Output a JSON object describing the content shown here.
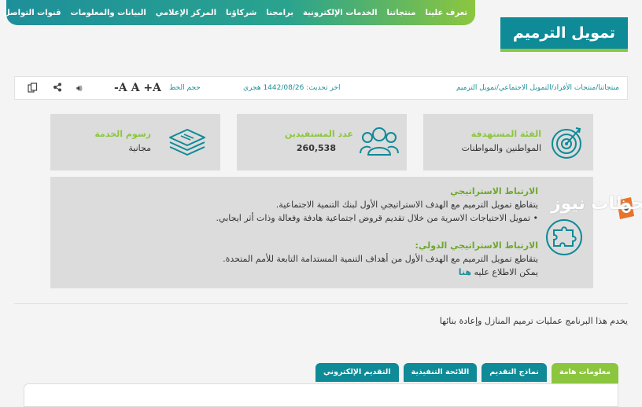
{
  "nav": {
    "items": [
      "تعرف علينا",
      "منتجاتنا",
      "الخدمات الإلكترونية",
      "برامجنا",
      "شركاؤنا",
      "المركز الإعلامي",
      "البيانات والمعلومات",
      "قنوات التواصل"
    ]
  },
  "page": {
    "title": "تمويل الترميم"
  },
  "toolbar": {
    "breadcrumb": "منتجاتنا/منتجات الأفراد/التمويل الاجتماعي/تمويل الترميم",
    "update_label": "اخر تحديث: 1442/08/26 هجري",
    "font_size_label": "حجم الخط",
    "font_sizes": {
      "small": "-A",
      "normal": "A",
      "large": "+A"
    }
  },
  "cards": {
    "target": {
      "label": "الفئة المستهدفة",
      "value": "المواطنين والمواطنات"
    },
    "beneficiaries": {
      "label": "عدد المستفيدين",
      "value": "260,538"
    },
    "fees": {
      "label": "رسوم الخدمة",
      "value": "مجانية"
    }
  },
  "strategy": {
    "title": "الارتباط الاستراتيجي",
    "line1": "يتقاطع تمويل الترميم مع الهدف الاستراتيجي الأول لبنك التنمية الاجتماعية.",
    "line2": "• تمويل الاحتياجات الاسرية من خلال تقديم قروض اجتماعية هادفة وفعالة وذات أثر ايجابي.",
    "intl_title": "الارتباط الاستراتيجي الدولي:",
    "intl_line": "يتقاطع تمويل الترميم مع الهدف الأول من أهداف التنمية المستدامة التابعة للأمم المتحدة.",
    "more_prefix": "يمكن الاطلاع عليه",
    "more_link": "هنا"
  },
  "description": "يخدم هذا البرنامج عمليات ترميم المنازل وإعادة بنائها",
  "tabs": [
    "معلومات هامة",
    "نماذج التقديم",
    "اللائحة التنفيذية",
    "التقديم الإلكتروني"
  ],
  "watermark": "لحظات نيوز",
  "colors": {
    "teal": "#0f8a97",
    "green": "#8cc63f",
    "card": "#dcdcdc"
  }
}
